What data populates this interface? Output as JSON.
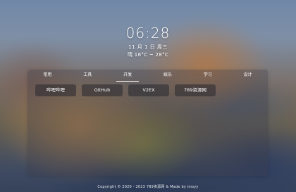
{
  "clock": {
    "time": "06:28",
    "date": "11 月 1 日 周三",
    "weather": "晴 16°C ~ 28°C"
  },
  "nav": {
    "tabs": [
      {
        "label": "常用"
      },
      {
        "label": "工具"
      },
      {
        "label": "开发",
        "active": true
      },
      {
        "label": "娱乐"
      },
      {
        "label": "学习"
      },
      {
        "label": "设计"
      }
    ]
  },
  "links": [
    {
      "label": "哔哩哔哩"
    },
    {
      "label": "GitHub"
    },
    {
      "label": "V2EX"
    },
    {
      "label": "789资源网"
    }
  ],
  "footer": {
    "text": "Copyright © 2020 - 2023 789资源网 &  Made by imsyy"
  }
}
